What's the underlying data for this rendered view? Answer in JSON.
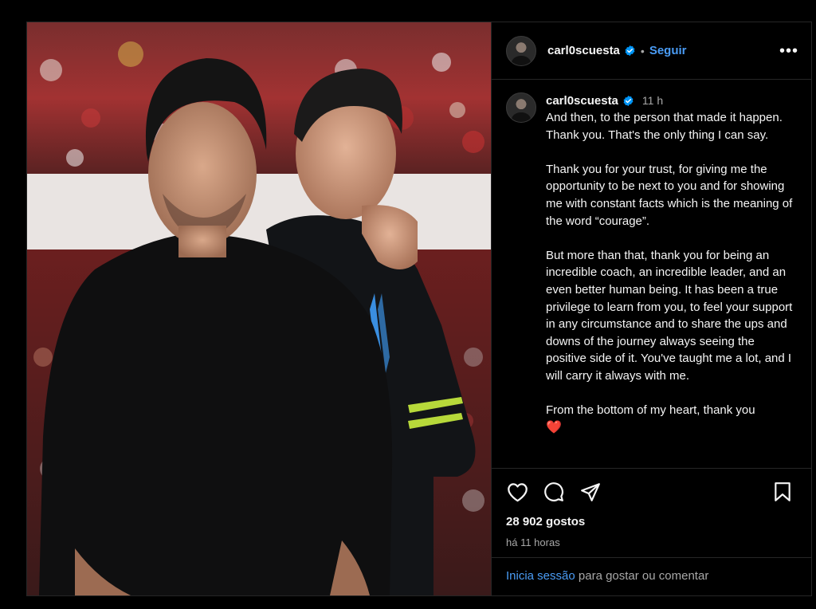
{
  "header": {
    "username": "carl0scuesta",
    "separator": "•",
    "follow_label": "Seguir",
    "more_label": "•••"
  },
  "caption": {
    "username": "carl0scuesta",
    "time": "11 h",
    "text": "And then, to the person that made it happen. Thank you. That's the only thing I can say.\n\nThank you for your trust, for giving me the opportunity to be next to you and for showing me with constant facts which is the meaning of the word “courage”.\n\nBut more than that, thank you for being an incredible coach, an incredible leader, and an even better human being. It has been a true privilege to learn from you, to feel your support in any circumstance and to share the ups and downs of the journey always seeing the positive side of it. You've taught me a lot, and I will carry it always with me.\n\nFrom the bottom of my heart, thank you",
    "emoji": "❤️"
  },
  "post": {
    "likes": "28 902 gostos",
    "posted_ago": "há 11 horas"
  },
  "footer": {
    "login_link": "Inicia sessão",
    "login_rest": " para gostar ou comentar"
  },
  "icons": {
    "like": "heart-icon",
    "comment": "comment-icon",
    "share": "share-icon",
    "save": "bookmark-icon",
    "verified": "verified-badge-icon"
  },
  "colors": {
    "background": "#000000",
    "link": "#4a9cf5",
    "verified": "#0095f6",
    "muted": "#a8a8a8"
  }
}
